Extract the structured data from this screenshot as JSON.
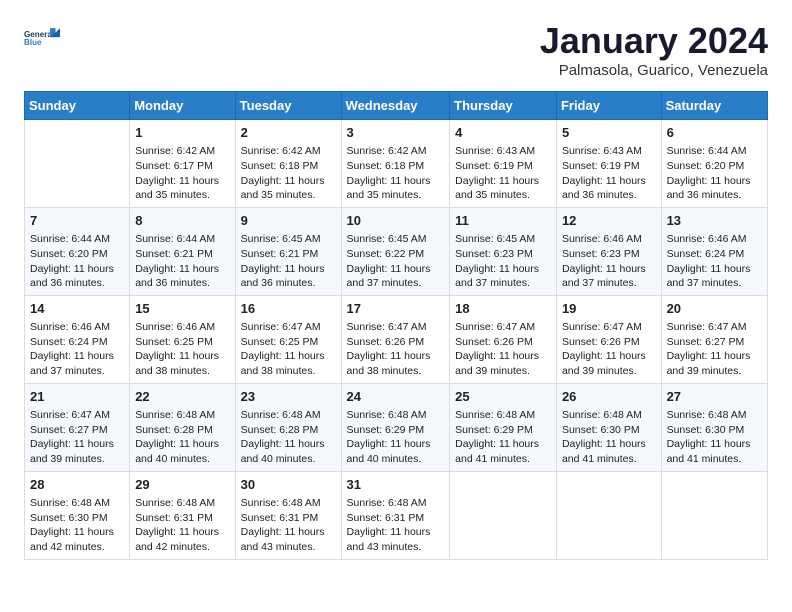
{
  "header": {
    "logo_line1": "General",
    "logo_line2": "Blue",
    "month_title": "January 2024",
    "subtitle": "Palmasola, Guarico, Venezuela"
  },
  "days_of_week": [
    "Sunday",
    "Monday",
    "Tuesday",
    "Wednesday",
    "Thursday",
    "Friday",
    "Saturday"
  ],
  "weeks": [
    [
      {
        "day": "",
        "info": ""
      },
      {
        "day": "1",
        "info": "Sunrise: 6:42 AM\nSunset: 6:17 PM\nDaylight: 11 hours\nand 35 minutes."
      },
      {
        "day": "2",
        "info": "Sunrise: 6:42 AM\nSunset: 6:18 PM\nDaylight: 11 hours\nand 35 minutes."
      },
      {
        "day": "3",
        "info": "Sunrise: 6:42 AM\nSunset: 6:18 PM\nDaylight: 11 hours\nand 35 minutes."
      },
      {
        "day": "4",
        "info": "Sunrise: 6:43 AM\nSunset: 6:19 PM\nDaylight: 11 hours\nand 35 minutes."
      },
      {
        "day": "5",
        "info": "Sunrise: 6:43 AM\nSunset: 6:19 PM\nDaylight: 11 hours\nand 36 minutes."
      },
      {
        "day": "6",
        "info": "Sunrise: 6:44 AM\nSunset: 6:20 PM\nDaylight: 11 hours\nand 36 minutes."
      }
    ],
    [
      {
        "day": "7",
        "info": "Sunrise: 6:44 AM\nSunset: 6:20 PM\nDaylight: 11 hours\nand 36 minutes."
      },
      {
        "day": "8",
        "info": "Sunrise: 6:44 AM\nSunset: 6:21 PM\nDaylight: 11 hours\nand 36 minutes."
      },
      {
        "day": "9",
        "info": "Sunrise: 6:45 AM\nSunset: 6:21 PM\nDaylight: 11 hours\nand 36 minutes."
      },
      {
        "day": "10",
        "info": "Sunrise: 6:45 AM\nSunset: 6:22 PM\nDaylight: 11 hours\nand 37 minutes."
      },
      {
        "day": "11",
        "info": "Sunrise: 6:45 AM\nSunset: 6:23 PM\nDaylight: 11 hours\nand 37 minutes."
      },
      {
        "day": "12",
        "info": "Sunrise: 6:46 AM\nSunset: 6:23 PM\nDaylight: 11 hours\nand 37 minutes."
      },
      {
        "day": "13",
        "info": "Sunrise: 6:46 AM\nSunset: 6:24 PM\nDaylight: 11 hours\nand 37 minutes."
      }
    ],
    [
      {
        "day": "14",
        "info": "Sunrise: 6:46 AM\nSunset: 6:24 PM\nDaylight: 11 hours\nand 37 minutes."
      },
      {
        "day": "15",
        "info": "Sunrise: 6:46 AM\nSunset: 6:25 PM\nDaylight: 11 hours\nand 38 minutes."
      },
      {
        "day": "16",
        "info": "Sunrise: 6:47 AM\nSunset: 6:25 PM\nDaylight: 11 hours\nand 38 minutes."
      },
      {
        "day": "17",
        "info": "Sunrise: 6:47 AM\nSunset: 6:26 PM\nDaylight: 11 hours\nand 38 minutes."
      },
      {
        "day": "18",
        "info": "Sunrise: 6:47 AM\nSunset: 6:26 PM\nDaylight: 11 hours\nand 39 minutes."
      },
      {
        "day": "19",
        "info": "Sunrise: 6:47 AM\nSunset: 6:26 PM\nDaylight: 11 hours\nand 39 minutes."
      },
      {
        "day": "20",
        "info": "Sunrise: 6:47 AM\nSunset: 6:27 PM\nDaylight: 11 hours\nand 39 minutes."
      }
    ],
    [
      {
        "day": "21",
        "info": "Sunrise: 6:47 AM\nSunset: 6:27 PM\nDaylight: 11 hours\nand 39 minutes."
      },
      {
        "day": "22",
        "info": "Sunrise: 6:48 AM\nSunset: 6:28 PM\nDaylight: 11 hours\nand 40 minutes."
      },
      {
        "day": "23",
        "info": "Sunrise: 6:48 AM\nSunset: 6:28 PM\nDaylight: 11 hours\nand 40 minutes."
      },
      {
        "day": "24",
        "info": "Sunrise: 6:48 AM\nSunset: 6:29 PM\nDaylight: 11 hours\nand 40 minutes."
      },
      {
        "day": "25",
        "info": "Sunrise: 6:48 AM\nSunset: 6:29 PM\nDaylight: 11 hours\nand 41 minutes."
      },
      {
        "day": "26",
        "info": "Sunrise: 6:48 AM\nSunset: 6:30 PM\nDaylight: 11 hours\nand 41 minutes."
      },
      {
        "day": "27",
        "info": "Sunrise: 6:48 AM\nSunset: 6:30 PM\nDaylight: 11 hours\nand 41 minutes."
      }
    ],
    [
      {
        "day": "28",
        "info": "Sunrise: 6:48 AM\nSunset: 6:30 PM\nDaylight: 11 hours\nand 42 minutes."
      },
      {
        "day": "29",
        "info": "Sunrise: 6:48 AM\nSunset: 6:31 PM\nDaylight: 11 hours\nand 42 minutes."
      },
      {
        "day": "30",
        "info": "Sunrise: 6:48 AM\nSunset: 6:31 PM\nDaylight: 11 hours\nand 43 minutes."
      },
      {
        "day": "31",
        "info": "Sunrise: 6:48 AM\nSunset: 6:31 PM\nDaylight: 11 hours\nand 43 minutes."
      },
      {
        "day": "",
        "info": ""
      },
      {
        "day": "",
        "info": ""
      },
      {
        "day": "",
        "info": ""
      }
    ]
  ]
}
